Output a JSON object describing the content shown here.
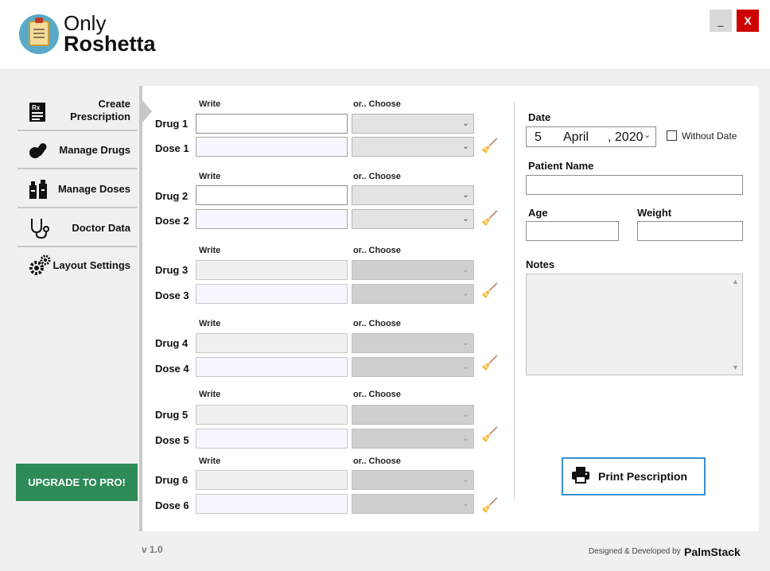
{
  "app": {
    "brand_top": "Only",
    "brand_bottom": "Roshetta",
    "minimize_label": "_",
    "close_label": "X"
  },
  "sidebar": {
    "items": [
      {
        "label": "Create\nPrescription",
        "icon": "prescription-icon"
      },
      {
        "label": "Manage Drugs",
        "icon": "pills-icon"
      },
      {
        "label": "Manage Doses",
        "icon": "bottles-icon"
      },
      {
        "label": "Doctor Data",
        "icon": "stethoscope-icon"
      },
      {
        "label": "Layout Settings",
        "icon": "gears-icon"
      }
    ],
    "upgrade_label": "UPGRADE TO PRO!",
    "version": "v 1.0"
  },
  "prescription": {
    "write_header": "Write",
    "choose_header": "or.. Choose",
    "rows": [
      {
        "drug_label": "Drug 1",
        "dose_label": "Dose 1"
      },
      {
        "drug_label": "Drug 2",
        "dose_label": "Dose 2"
      },
      {
        "drug_label": "Drug 3",
        "dose_label": "Dose 3"
      },
      {
        "drug_label": "Drug 4",
        "dose_label": "Dose 4"
      },
      {
        "drug_label": "Drug 5",
        "dose_label": "Dose 5"
      },
      {
        "drug_label": "Drug 6",
        "dose_label": "Dose 6"
      }
    ]
  },
  "form": {
    "date_label": "Date",
    "date_day": "5",
    "date_month": "April",
    "date_year": ", 2020",
    "without_date_label": "Without Date",
    "patient_name_label": "Patient Name",
    "age_label": "Age",
    "weight_label": "Weight",
    "notes_label": "Notes",
    "print_label": "Print Pescription"
  },
  "footer": {
    "credit": "Designed & Developed by",
    "credit_brand": "PalmStack"
  },
  "colors": {
    "accent_green": "#2e8b57",
    "close_red": "#cc0000",
    "print_border": "#3a8fd0"
  }
}
